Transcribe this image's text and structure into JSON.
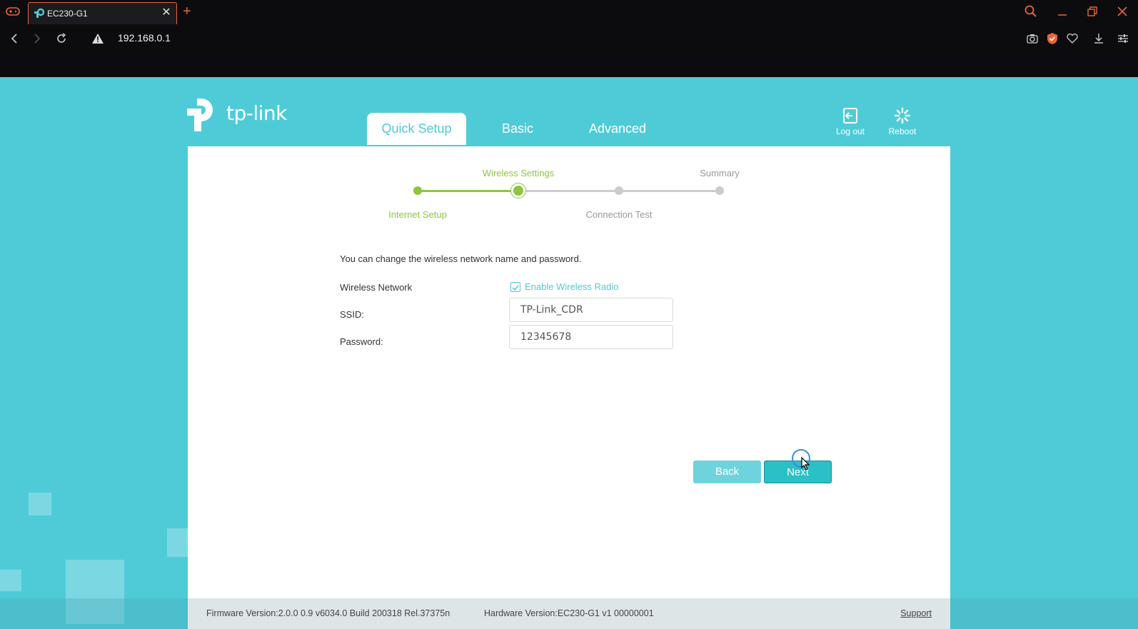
{
  "browser": {
    "tab_title": "EC230-G1",
    "url": "192.168.0.1",
    "accent": "#e8643a"
  },
  "header": {
    "logo_text": "tp-link",
    "tabs": [
      {
        "label": "Quick Setup",
        "active": true
      },
      {
        "label": "Basic",
        "active": false
      },
      {
        "label": "Advanced",
        "active": false
      }
    ],
    "logout_label": "Log out",
    "reboot_label": "Reboot"
  },
  "progress": {
    "steps": [
      {
        "label": "Internet Setup",
        "state": "done"
      },
      {
        "label": "Wireless Settings",
        "state": "current"
      },
      {
        "label": "Connection Test",
        "state": "todo"
      },
      {
        "label": "Summary",
        "state": "todo"
      }
    ],
    "done_color": "#8cc63f",
    "todo_color": "#cccccc"
  },
  "form": {
    "description": "You can change the wireless network name and password.",
    "wireless_label": "Wireless Network",
    "enable_radio_label": "Enable Wireless Radio",
    "enable_radio_checked": true,
    "ssid_label": "SSID:",
    "ssid_value": "TP-Link_CDR",
    "password_label": "Password:",
    "password_value": "12345678"
  },
  "buttons": {
    "back": "Back",
    "next": "Next"
  },
  "footer": {
    "firmware": "Firmware Version:2.0.0 0.9 v6034.0 Build 200318 Rel.37375n",
    "hardware": "Hardware Version:EC230-G1 v1 00000001",
    "support": "Support"
  },
  "brand_color": "#4fcbd8"
}
